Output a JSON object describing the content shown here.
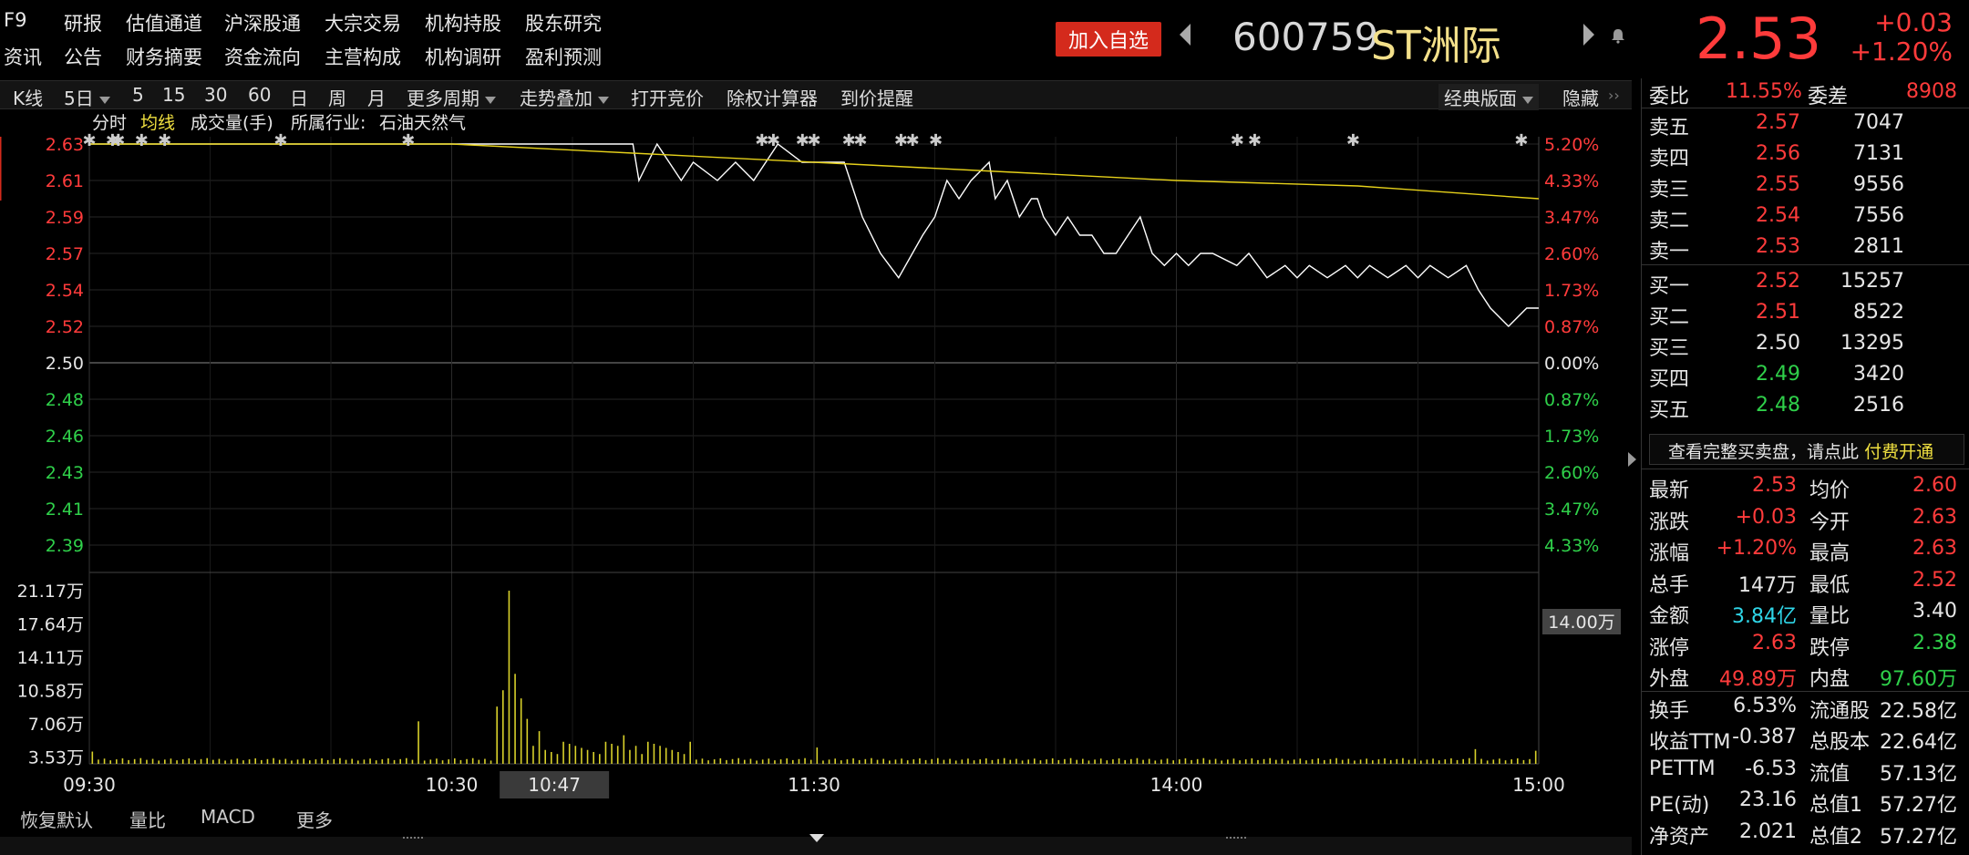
{
  "top_nav": {
    "row1": [
      "F9",
      "研报",
      "估值通道",
      "沪深股通",
      "大宗交易",
      "机构持股",
      "股东研究"
    ],
    "row2": [
      "资讯",
      "公告",
      "财务摘要",
      "资金流向",
      "主营构成",
      "机构调研",
      "盈利预测"
    ]
  },
  "header": {
    "add_watch": "加入自选",
    "code": "600759",
    "name": "ST洲际",
    "price": "2.53",
    "change": "+0.03",
    "change_pct": "+1.20%"
  },
  "toolbar": {
    "items": [
      "K线",
      "5日",
      "5",
      "15",
      "30",
      "60",
      "日",
      "周",
      "月",
      "更多周期",
      "走势叠加",
      "打开竞价",
      "除权计算器",
      "到价提醒"
    ],
    "layout": "经典版面",
    "hide": "隐藏"
  },
  "subbar": {
    "items": [
      "分时",
      "均线",
      "成交量(手)",
      "所属行业:",
      "石油天然气"
    ]
  },
  "chart_data": {
    "type": "line",
    "price_axis": {
      "ticks_left": [
        "2.63",
        "2.61",
        "2.59",
        "2.57",
        "2.54",
        "2.52",
        "2.50",
        "2.48",
        "2.46",
        "2.43",
        "2.41",
        "2.39"
      ],
      "ticks_right": [
        "5.20%",
        "4.33%",
        "3.47%",
        "2.60%",
        "1.73%",
        "0.87%",
        "0.00%",
        "0.87%",
        "1.73%",
        "2.60%",
        "3.47%",
        "4.33%"
      ],
      "ylim": [
        2.37,
        2.63
      ],
      "prev_close": 2.5
    },
    "volume_axis": {
      "ticks": [
        "21.17万",
        "17.64万",
        "14.11万",
        "10.58万",
        "7.06万",
        "3.53万"
      ],
      "ylim": [
        0,
        211700
      ],
      "cursor_label": "14.00万"
    },
    "x_ticks": [
      "09:30",
      "10:30",
      "10:47",
      "11:30",
      "14:00",
      "15:00"
    ],
    "series": [
      {
        "name": "分时",
        "color": "#ffffff",
        "minute": [
          0,
          90,
          91,
          94,
          98,
          100,
          104,
          107,
          110,
          114,
          118,
          122,
          125,
          128,
          131,
          134,
          138,
          140,
          141,
          142,
          144,
          146,
          149,
          150,
          152,
          154,
          156,
          157,
          158,
          160,
          162,
          164,
          166,
          168,
          170,
          172,
          174,
          176,
          178,
          180,
          182,
          184,
          186,
          190,
          192,
          195,
          198,
          200,
          202,
          205,
          208,
          210,
          212,
          215,
          218,
          220,
          222,
          225,
          228,
          230,
          232,
          235,
          238,
          240
        ],
        "values": [
          2.63,
          2.63,
          2.61,
          2.63,
          2.61,
          2.62,
          2.61,
          2.62,
          2.61,
          2.63,
          2.62,
          2.62,
          2.62,
          2.59,
          2.57,
          2.55,
          2.58,
          2.59,
          2.6,
          2.61,
          2.6,
          2.61,
          2.62,
          2.6,
          2.61,
          2.59,
          2.6,
          2.6,
          2.59,
          2.58,
          2.59,
          2.58,
          2.58,
          2.57,
          2.57,
          2.58,
          2.59,
          2.57,
          2.56,
          2.57,
          2.56,
          2.57,
          2.57,
          2.56,
          2.57,
          2.55,
          2.56,
          2.55,
          2.56,
          2.55,
          2.56,
          2.55,
          2.56,
          2.55,
          2.56,
          2.55,
          2.56,
          2.55,
          2.56,
          2.54,
          2.53,
          2.52,
          2.53,
          2.53
        ]
      },
      {
        "name": "均线",
        "color": "#e6d11a",
        "minute": [
          0,
          60,
          90,
          120,
          150,
          180,
          210,
          240
        ],
        "values": [
          2.63,
          2.63,
          2.625,
          2.62,
          2.615,
          2.61,
          2.607,
          2.6
        ]
      }
    ],
    "volume": {
      "color": "#d8d02a",
      "peaks": [
        {
          "minute": 0,
          "value": 15000
        },
        {
          "minute": 54,
          "value": 52000
        },
        {
          "minute": 67,
          "value": 70000
        },
        {
          "minute": 68,
          "value": 90000
        },
        {
          "minute": 69,
          "value": 211700
        },
        {
          "minute": 70,
          "value": 110000
        },
        {
          "minute": 71,
          "value": 80000
        },
        {
          "minute": 72,
          "value": 55000
        },
        {
          "minute": 74,
          "value": 40000
        },
        {
          "minute": 88,
          "value": 35000
        },
        {
          "minute": 90,
          "value": 22000
        },
        {
          "minute": 120,
          "value": 20000
        },
        {
          "minute": 229,
          "value": 18000
        },
        {
          "minute": 239,
          "value": 16000
        }
      ],
      "base": 4000
    }
  },
  "bottom_tabs": [
    "恢复默认",
    "量比",
    "MACD",
    "更多"
  ],
  "quote": {
    "webi_label": "委比",
    "webi_value": "11.55%",
    "wecha_label": "委差",
    "wecha_value": "8908",
    "sell": [
      {
        "label": "卖五",
        "price": "2.57",
        "vol": "7047"
      },
      {
        "label": "卖四",
        "price": "2.56",
        "vol": "7131"
      },
      {
        "label": "卖三",
        "price": "2.55",
        "vol": "9556"
      },
      {
        "label": "卖二",
        "price": "2.54",
        "vol": "7556"
      },
      {
        "label": "卖一",
        "price": "2.53",
        "vol": "2811"
      }
    ],
    "buy": [
      {
        "label": "买一",
        "price": "2.52",
        "vol": "15257"
      },
      {
        "label": "买二",
        "price": "2.51",
        "vol": "8522"
      },
      {
        "label": "买三",
        "price": "2.50",
        "vol": "13295"
      },
      {
        "label": "买四",
        "price": "2.49",
        "vol": "3420"
      },
      {
        "label": "买五",
        "price": "2.48",
        "vol": "2516"
      }
    ],
    "banner_text": "查看完整买卖盘，请点此",
    "banner_link": "付费开通"
  },
  "stats": [
    {
      "l1": "最新",
      "v1": "2.53",
      "c1": "red",
      "l2": "均价",
      "v2": "2.60",
      "c2": "red"
    },
    {
      "l1": "涨跌",
      "v1": "+0.03",
      "c1": "red",
      "l2": "今开",
      "v2": "2.63",
      "c2": "red"
    },
    {
      "l1": "涨幅",
      "v1": "+1.20%",
      "c1": "red",
      "l2": "最高",
      "v2": "2.63",
      "c2": "red"
    },
    {
      "l1": "总手",
      "v1": "147万",
      "c1": "white",
      "l2": "最低",
      "v2": "2.52",
      "c2": "red"
    },
    {
      "l1": "金额",
      "v1": "3.84亿",
      "c1": "cyan",
      "l2": "量比",
      "v2": "3.40",
      "c2": "white"
    },
    {
      "l1": "涨停",
      "v1": "2.63",
      "c1": "red",
      "l2": "跌停",
      "v2": "2.38",
      "c2": "green"
    },
    {
      "l1": "外盘",
      "v1": "49.89万",
      "c1": "red",
      "l2": "内盘",
      "v2": "97.60万",
      "c2": "green"
    },
    {
      "l1": "换手",
      "v1": "6.53%",
      "c1": "white",
      "l2": "流通股",
      "v2": "22.58亿",
      "c2": "white"
    },
    {
      "l1": "收益TTM",
      "v1": "-0.387",
      "c1": "white",
      "l2": "总股本",
      "v2": "22.64亿",
      "c2": "white"
    },
    {
      "l1": "PETTM",
      "v1": "-6.53",
      "c1": "white",
      "l2": "流值",
      "v2": "57.13亿",
      "c2": "white"
    },
    {
      "l1": "PE(动)",
      "v1": "23.16",
      "c1": "white",
      "l2": "总值1",
      "v2": "57.27亿",
      "c2": "white"
    },
    {
      "l1": "净资产",
      "v1": "2.021",
      "c1": "white",
      "l2": "总值2",
      "v2": "57.27亿",
      "c2": "white"
    }
  ]
}
